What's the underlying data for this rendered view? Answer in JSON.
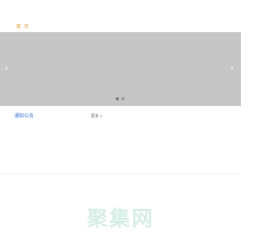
{
  "header": {
    "home_label": "首 页"
  },
  "carousel": {
    "prev_icon": "‹",
    "next_icon": "›",
    "indicator_count": 2,
    "active_index": 0
  },
  "notice": {
    "title": "通知公告",
    "more_label": "更多 »"
  },
  "watermark": {
    "text": "聚集网"
  },
  "colors": {
    "accent": "#e8a23c",
    "link": "#3b6fd1",
    "carousel_bg": "#c6c6c6",
    "watermark": "#d7efe7"
  }
}
